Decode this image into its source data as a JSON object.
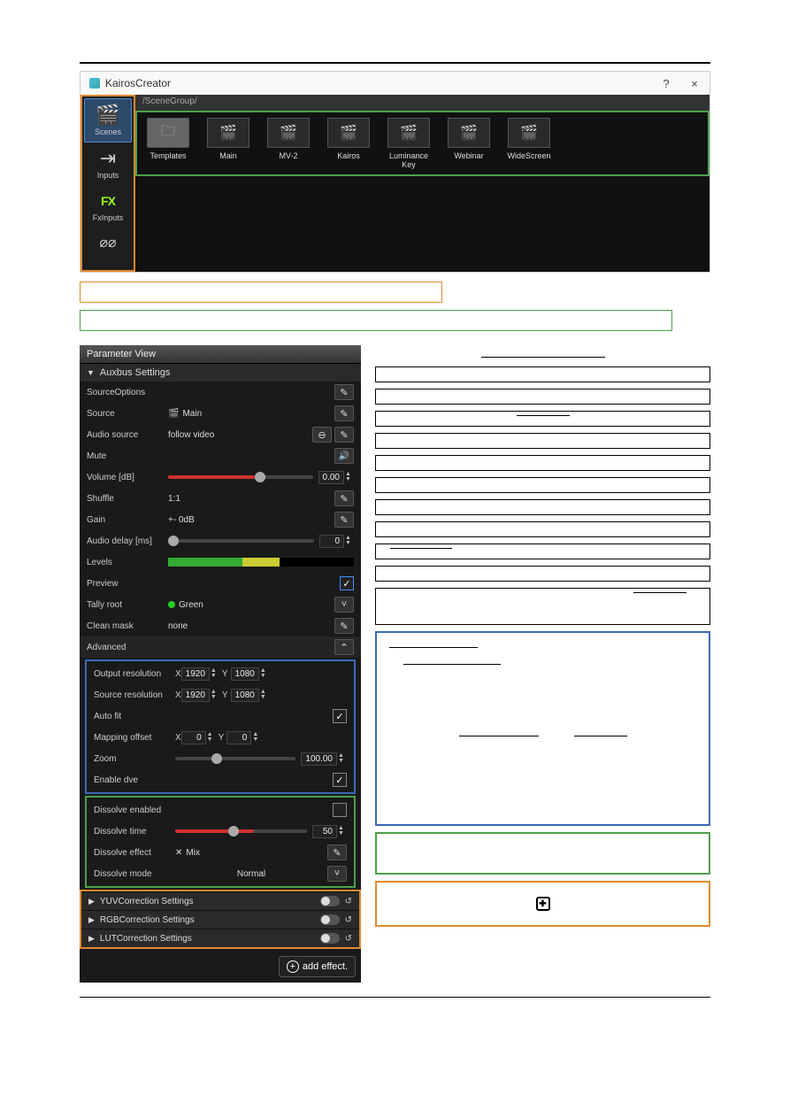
{
  "app": {
    "title": "KairosCreator",
    "help": "?",
    "close": "×"
  },
  "sidebar": {
    "items": [
      {
        "label": "Scenes",
        "glyph": "🎬",
        "sel": true
      },
      {
        "label": "Inputs",
        "glyph": "⇥",
        "sel": false
      },
      {
        "label": "FxInputs",
        "glyph": "FX",
        "sel": false,
        "fx": true
      },
      {
        "label": "",
        "glyph": "⌀⌀",
        "sel": false,
        "rec": true
      }
    ]
  },
  "breadcrumb": "/SceneGroup/",
  "scenes": [
    {
      "label": "Templates",
      "folder": true
    },
    {
      "label": "Main"
    },
    {
      "label": "MV-2"
    },
    {
      "label": "Kairos"
    },
    {
      "label": "Luminance Key"
    },
    {
      "label": "Webinar"
    },
    {
      "label": "WideScreen"
    }
  ],
  "param": {
    "title": "Parameter View",
    "auxbus": "Auxbus Settings",
    "sourceOptions": "SourceOptions",
    "source_label": "Source",
    "source_value": "Main",
    "audio_source_label": "Audio source",
    "audio_source_value": "follow video",
    "mute_label": "Mute",
    "volume_label": "Volume [dB]",
    "volume_value": "0.00",
    "shuffle_label": "Shuffle",
    "shuffle_value": "1:1",
    "gain_label": "Gain",
    "gain_value": "+- 0dB",
    "audio_delay_label": "Audio delay [ms]",
    "audio_delay_value": "0",
    "levels_label": "Levels",
    "preview_label": "Preview",
    "tally_label": "Tally root",
    "tally_value": "Green",
    "clean_mask_label": "Clean mask",
    "clean_mask_value": "none",
    "advanced_label": "Advanced",
    "out_res_label": "Output resolution",
    "out_res_x": "1920",
    "out_res_y": "1080",
    "src_res_label": "Source resolution",
    "src_res_x": "1920",
    "src_res_y": "1080",
    "autofit_label": "Auto fit",
    "map_off_label": "Mapping offset",
    "map_off_x": "0",
    "map_off_y": "0",
    "zoom_label": "Zoom",
    "zoom_value": "100.00",
    "enable_dve_label": "Enable dve",
    "dis_en_label": "Dissolve enabled",
    "dis_time_label": "Dissolve time",
    "dis_time_value": "50",
    "dis_eff_label": "Dissolve effect",
    "dis_eff_value": "Mix",
    "dis_mode_label": "Dissolve mode",
    "dis_mode_value": "Normal",
    "yuv_label": "YUVCorrection Settings",
    "rgb_label": "RGBCorrection Settings",
    "lut_label": "LUTCorrection Settings",
    "add_effect": "add effect.",
    "x": "X",
    "y": "Y",
    "check": "✓"
  }
}
